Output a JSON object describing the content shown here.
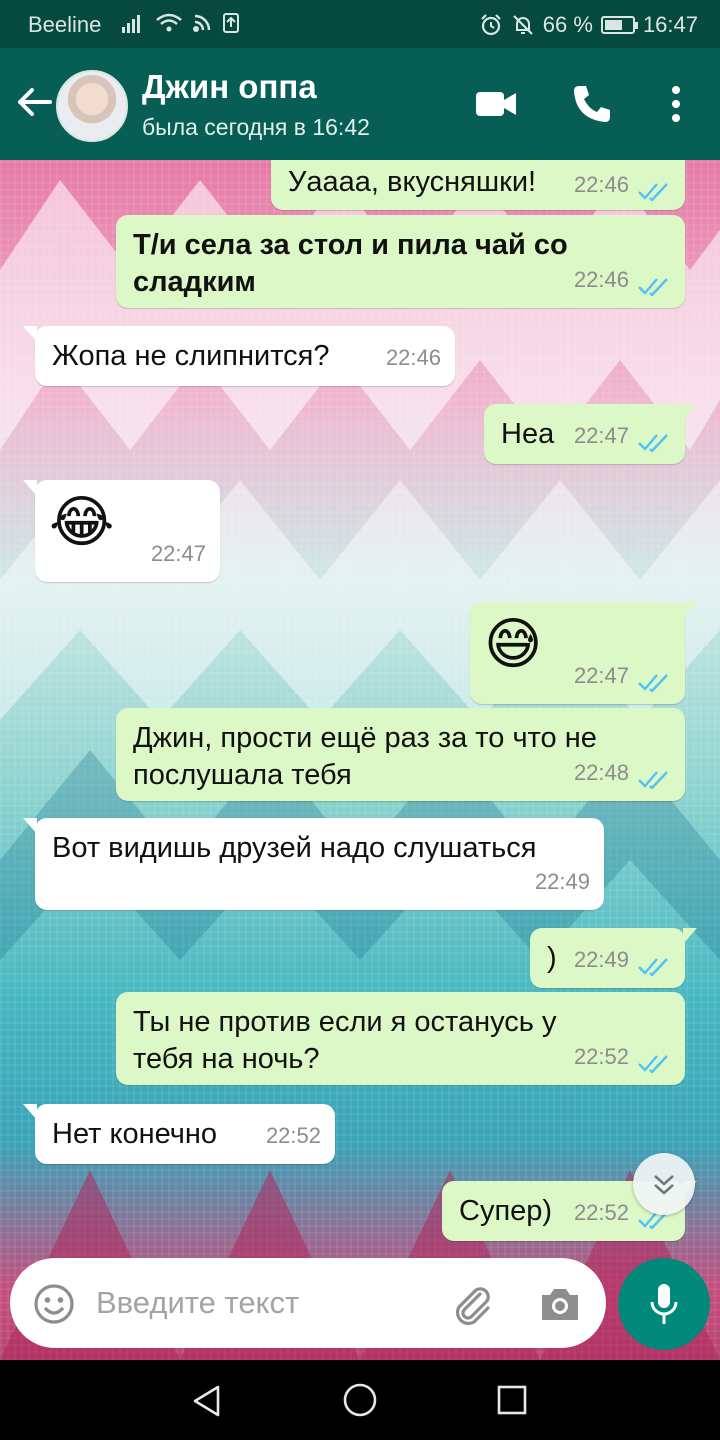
{
  "status_bar": {
    "carrier": "Beeline",
    "battery_text": "66 %",
    "battery_level": 0.66,
    "time": "16:47"
  },
  "header": {
    "contact_name": "Джин оппа",
    "last_seen": "была сегодня в 16:42"
  },
  "messages": [
    {
      "direction": "out",
      "text": "Уаааа, вкусняшки!",
      "time": "22:46"
    },
    {
      "direction": "out",
      "lines": [
        "Т/и села за стол и пила чай со",
        "сладким"
      ],
      "bold": true,
      "time": "22:46"
    },
    {
      "direction": "in",
      "text": "Жопа не слипнится?",
      "time": "22:46"
    },
    {
      "direction": "out",
      "text": "Неа",
      "time": "22:47"
    },
    {
      "direction": "in",
      "emoji": "😂",
      "time": "22:47"
    },
    {
      "direction": "out",
      "emoji": "😅",
      "time": "22:47"
    },
    {
      "direction": "out",
      "lines": [
        "Джин, прости ещё раз за то что не",
        "послушала тебя"
      ],
      "time": "22:48"
    },
    {
      "direction": "in",
      "text": "Вот видишь друзей надо слушаться",
      "time": "22:49"
    },
    {
      "direction": "out",
      "text": ")",
      "time": "22:49"
    },
    {
      "direction": "out",
      "lines": [
        "Ты не против если я останусь у",
        "тебя на ночь?"
      ],
      "time": "22:52"
    },
    {
      "direction": "in",
      "text": "Нет конечно",
      "time": "22:52"
    },
    {
      "direction": "out",
      "text": "Супер)",
      "time": "22:52"
    }
  ],
  "composer": {
    "placeholder": "Введите текст"
  },
  "icons": {
    "back": "arrow-left-icon",
    "video": "video-call-icon",
    "call": "phone-icon",
    "menu": "more-vertical-icon",
    "emoji": "emoji-icon",
    "attach": "paperclip-icon",
    "camera": "camera-icon",
    "mic": "microphone-icon",
    "scroll": "chevron-double-down-icon"
  },
  "colors": {
    "header": "#075e54",
    "status_bar": "#06493f",
    "bubble_out": "#dcf8c6",
    "bubble_in": "#ffffff",
    "read_ticks": "#4fc3f7",
    "accent": "#00897b"
  }
}
